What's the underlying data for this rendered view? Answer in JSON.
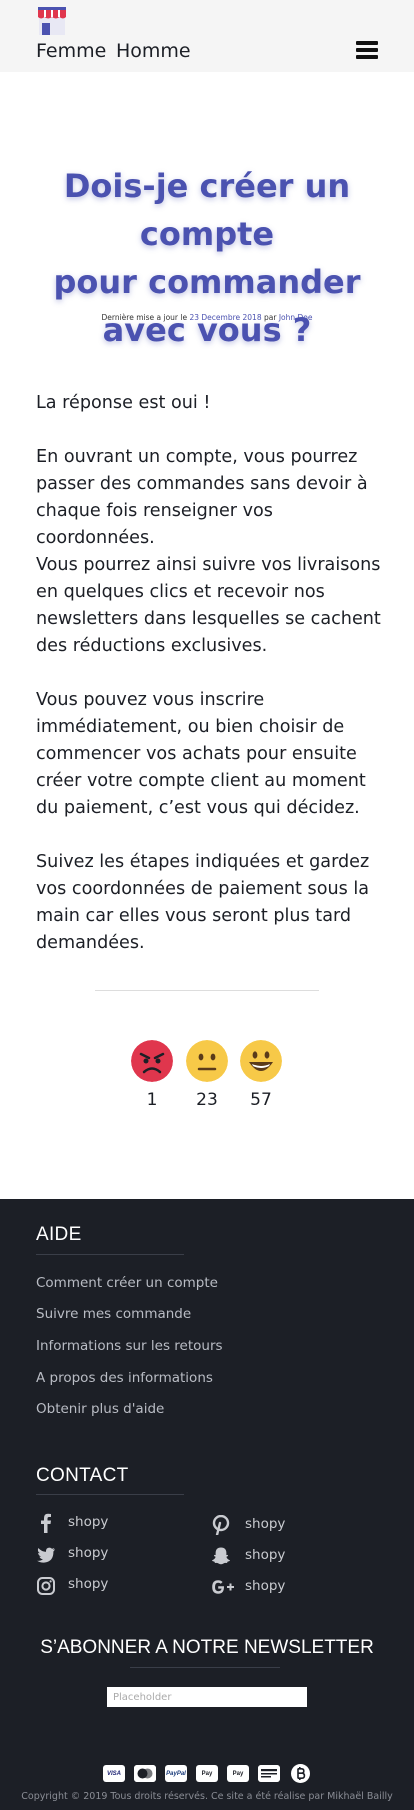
{
  "header": {
    "nav": [
      "Femme",
      "Homme"
    ]
  },
  "article": {
    "title_lines": [
      "Dois-je créer un compte",
      "pour commander",
      "avec vous ?"
    ],
    "meta_prefix": "Dernière mise a jour le ",
    "date": "23 Decembre 2018",
    "meta_by": " par ",
    "author": "John Doe",
    "paragraphs": [
      "La réponse est oui !",
      "En ouvrant un compte, vous pourrez passer des commandes sans devoir à chaque fois renseigner vos coordonnées.",
      "Vous pourrez ainsi suivre vos livraisons en quelques clics et recevoir nos newsletters dans lesquelles se cachent des réductions exclusives.",
      "Vous pouvez vous inscrire immédiatement, ou bien choisir de commencer vos achats pour ensuite créer votre compte client au moment du paiement, c’est vous qui décidez.",
      "Suivez les étapes indiquées et gardez vos coordonnées de paiement sous la main car elles vous seront plus tard demandées."
    ]
  },
  "reactions": [
    {
      "icon": "angry-face-icon",
      "count": "1",
      "color": "#e0364d"
    },
    {
      "icon": "neutral-face-icon",
      "count": "23",
      "color": "#f7c948"
    },
    {
      "icon": "happy-face-icon",
      "count": "57",
      "color": "#f7c948"
    }
  ],
  "footer": {
    "help_title": "AIDE",
    "help_links": [
      "Comment créer un compte",
      "Suivre mes commande",
      "Informations sur les retours",
      "A propos des informations",
      "Obtenir plus d'aide"
    ],
    "contact_title": "CONTACT",
    "contacts": [
      {
        "icon": "facebook-icon",
        "label": "shopy"
      },
      {
        "icon": "pinterest-icon",
        "label": "shopy"
      },
      {
        "icon": "twitter-icon",
        "label": "shopy"
      },
      {
        "icon": "snapchat-icon",
        "label": "shopy"
      },
      {
        "icon": "instagram-icon",
        "label": "shopy"
      },
      {
        "icon": "google-plus-icon",
        "label": "shopy"
      }
    ],
    "newsletter_title": "S’ABONNER A NOTRE NEWSLETTER",
    "newsletter_placeholder": "Placeholder",
    "payments": [
      "VISA",
      "mastercard-icon",
      "PayPal",
      "Pay",
      "Pay",
      "bank-card-icon",
      "bitcoin-icon"
    ],
    "copyright": "Copyright © 2019 Tous droits réservés. Ce site a été réalise par Mikhaël Bailly"
  },
  "colors": {
    "accent": "#4b52b0",
    "footer_bg": "#1c1f26"
  }
}
